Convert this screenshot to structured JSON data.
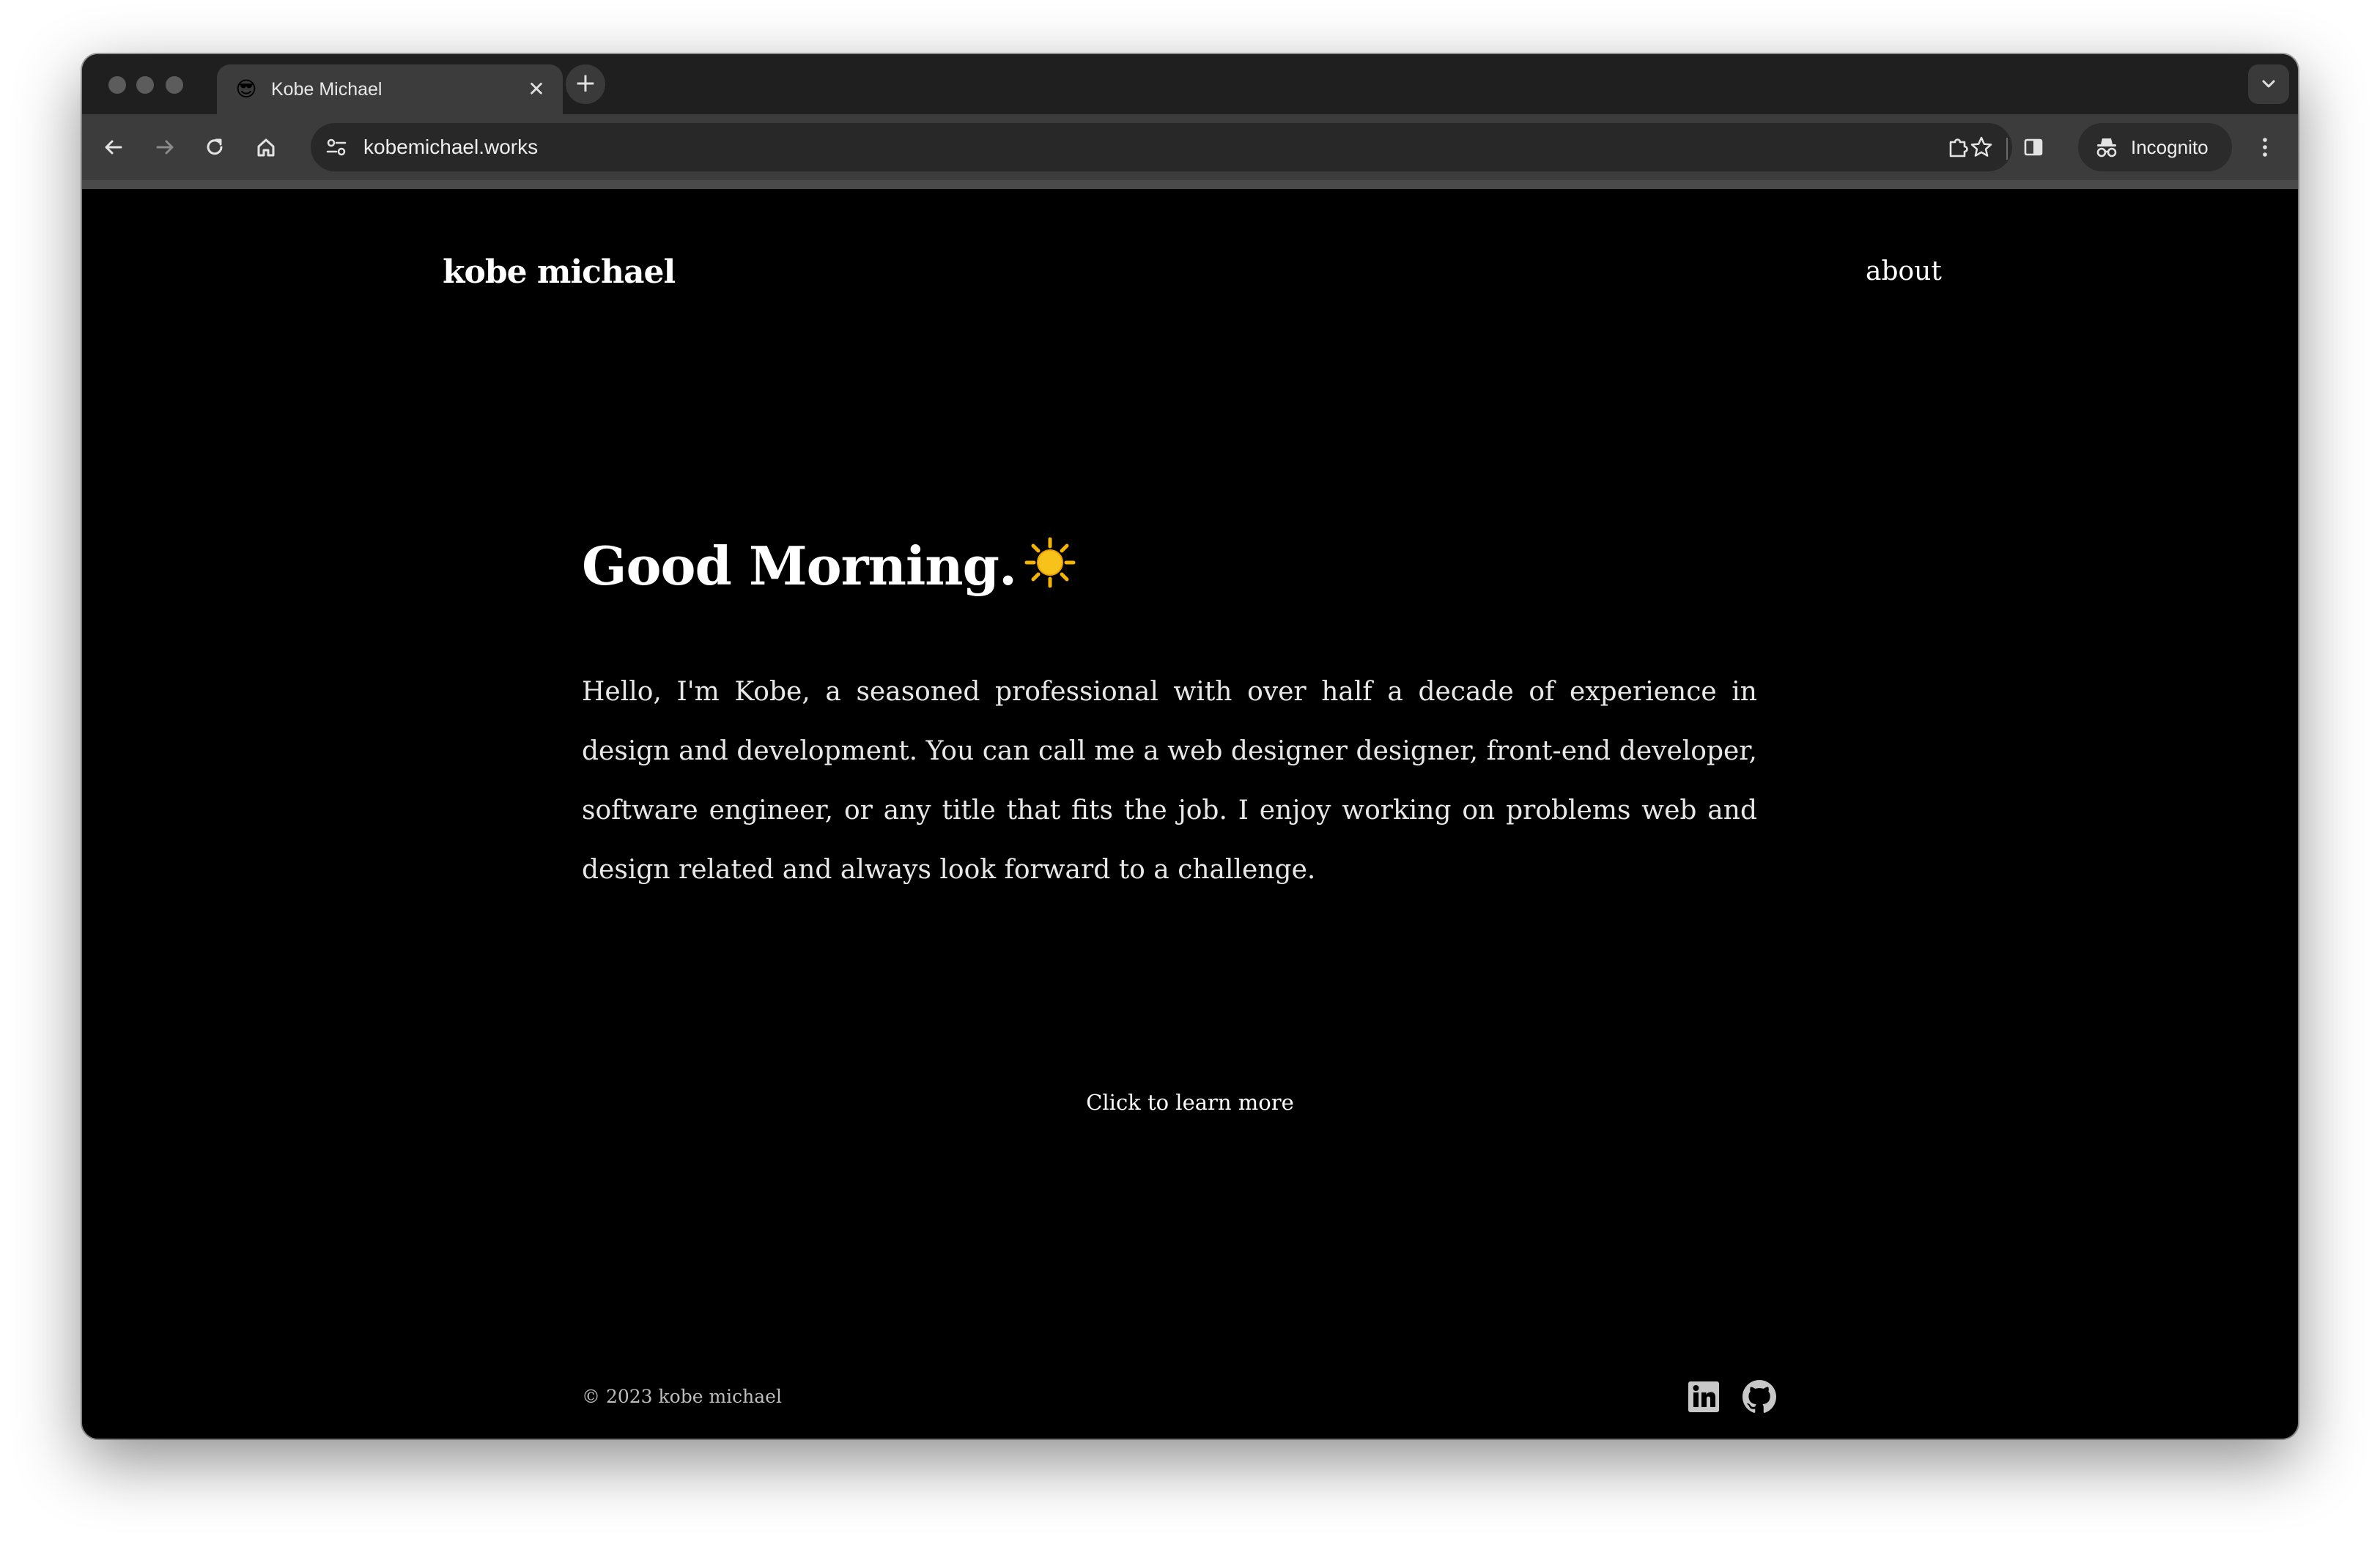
{
  "browser": {
    "tab": {
      "favicon": "😎",
      "title": "Kobe Michael",
      "close_glyph": "✕"
    },
    "new_tab_glyph": "+",
    "url": "kobemichael.works",
    "incognito_label": "Incognito"
  },
  "site": {
    "logo": "kobe michael",
    "nav": {
      "about": "about"
    },
    "hero": {
      "greeting": "Good Morning.",
      "intro": "Hello, I'm Kobe, a seasoned professional with over half a decade of experience in design and development. You can call me a web designer designer, front-end developer, software engineer, or any title that fits the job. I enjoy working on problems web and design related and always look forward to a challenge."
    },
    "cta": "Click to learn more",
    "footer": {
      "copyright": "© 2023 kobe michael",
      "social": [
        "linkedin-icon",
        "github-icon"
      ]
    }
  },
  "colors": {
    "page_bg": "#000000",
    "chrome_tabstrip": "#1f1f1f",
    "chrome_toolbar": "#3c3c3c",
    "text": "#ffffff",
    "muted_text": "#bdbdbd",
    "sun": "#f5b400"
  }
}
